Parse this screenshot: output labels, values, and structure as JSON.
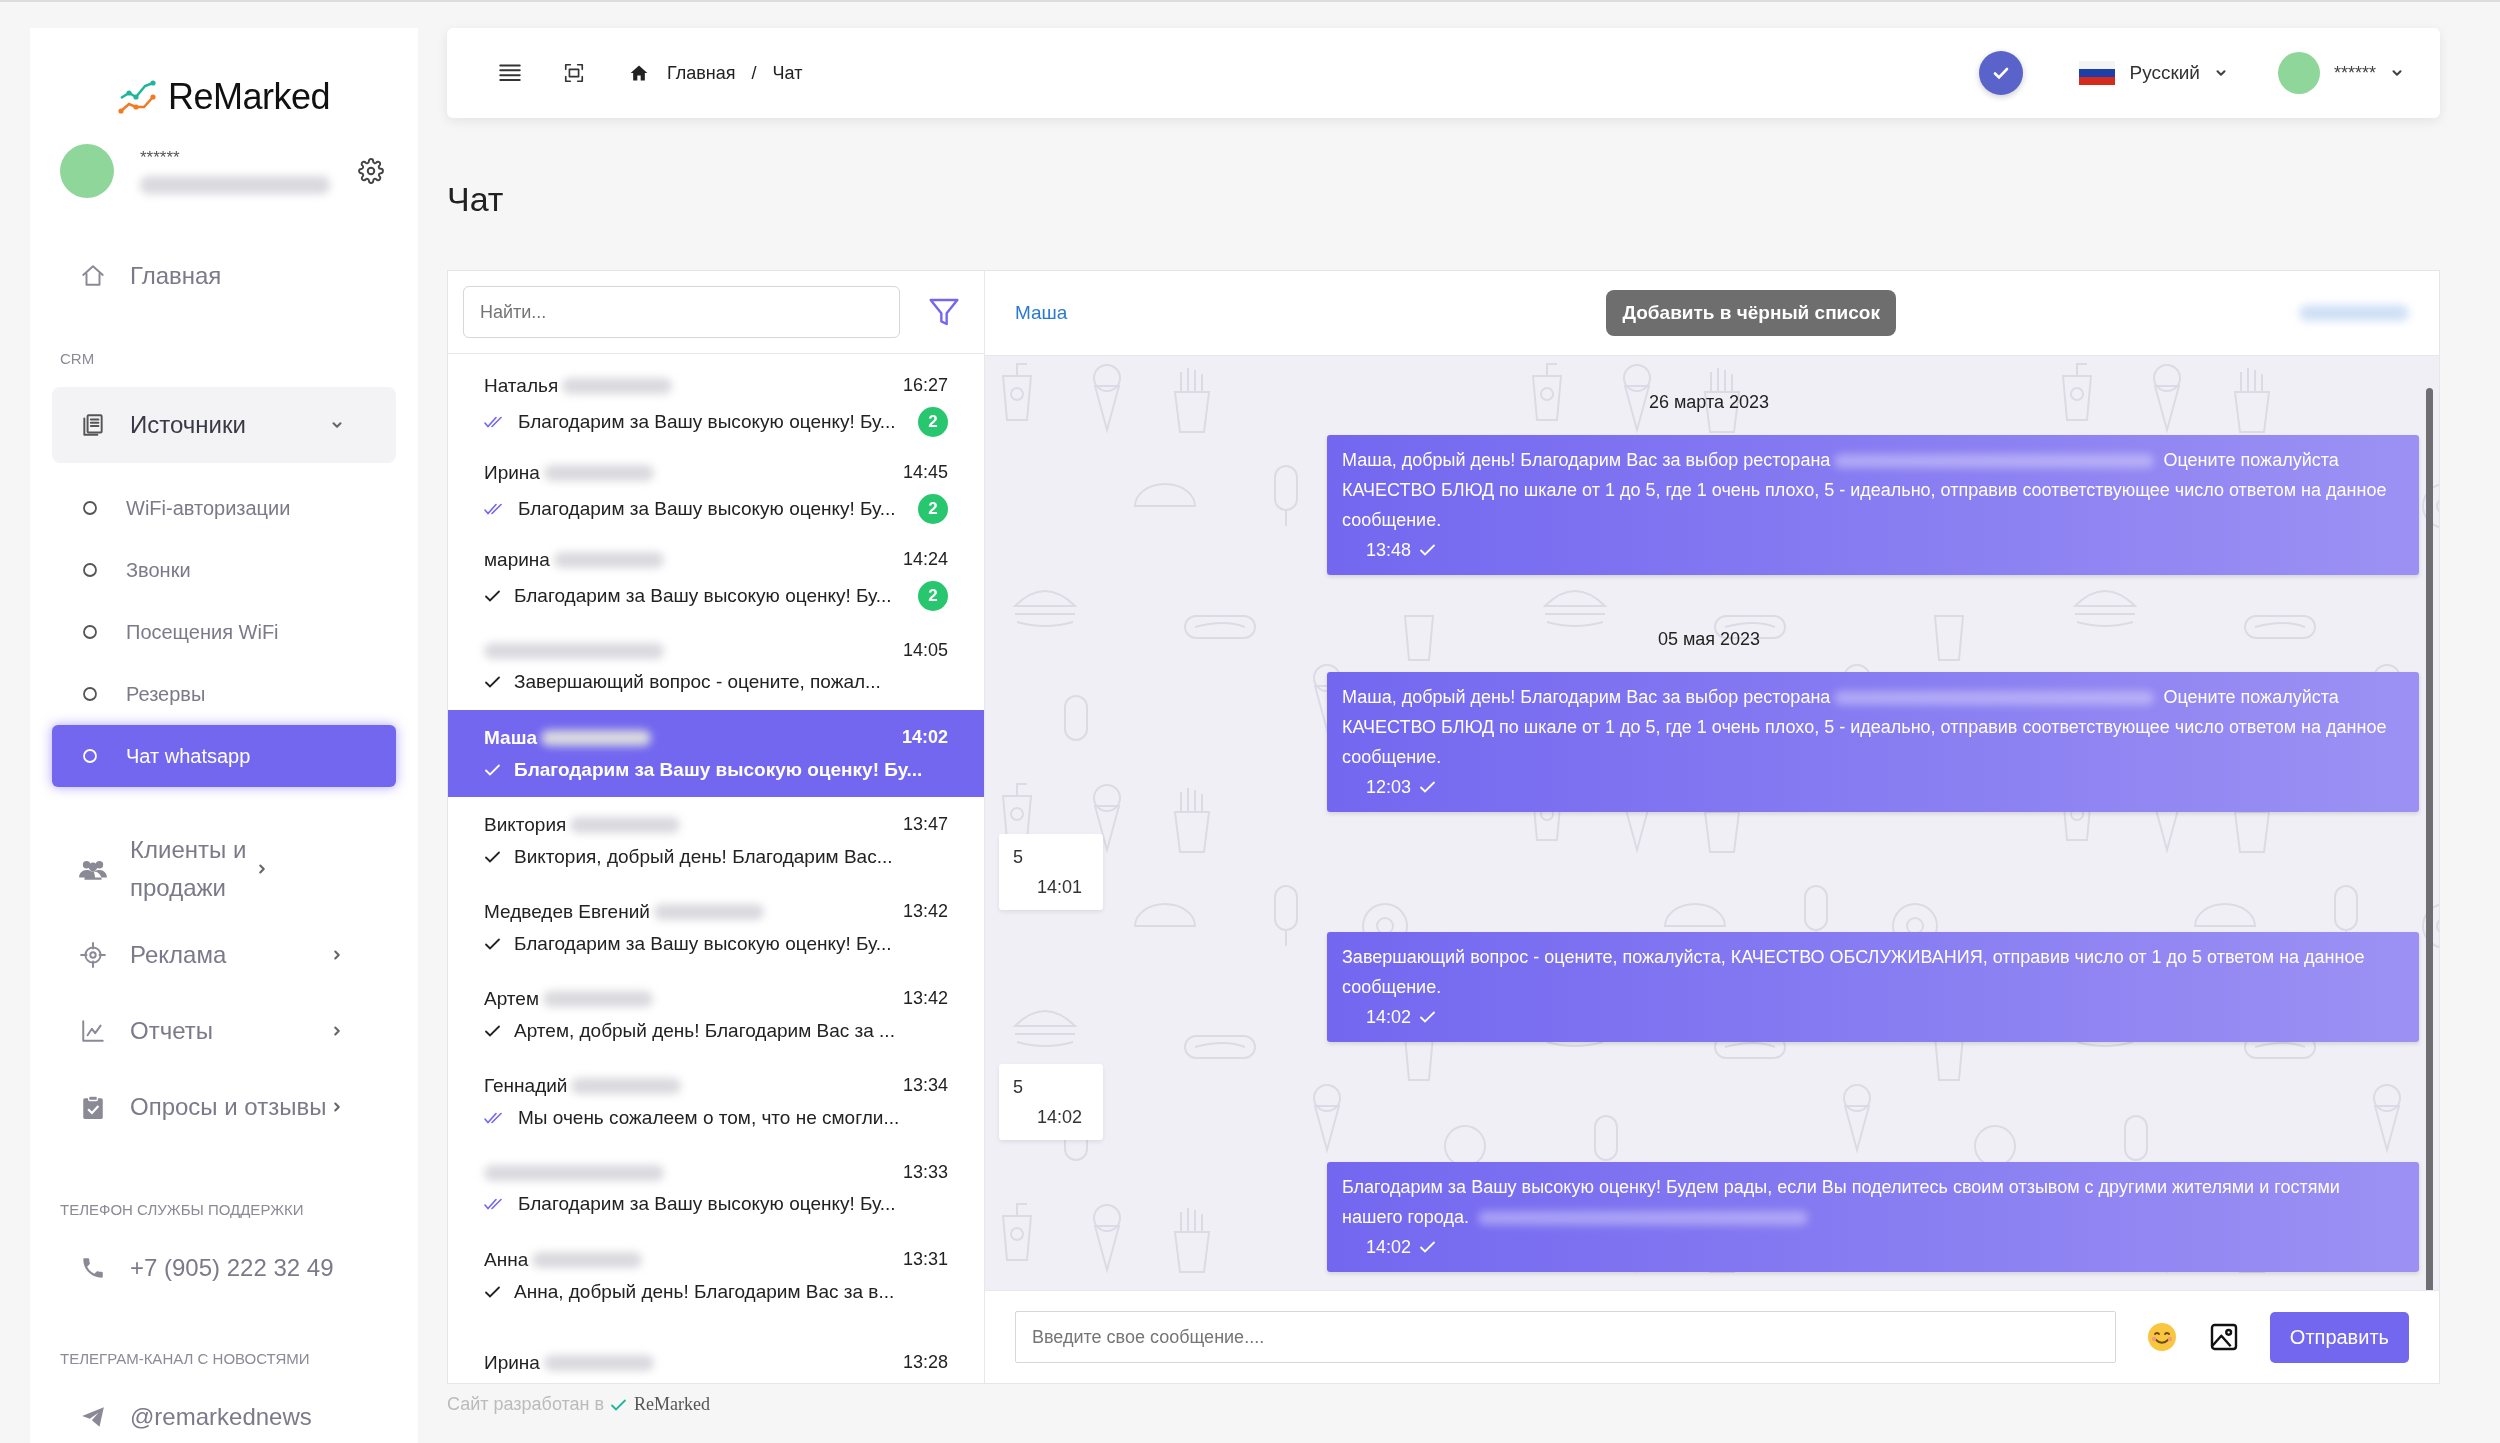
{
  "sidebar": {
    "logo": "ReMarked",
    "user": {
      "name": "******"
    },
    "nav": [
      {
        "kind": "link",
        "label": "Главная"
      },
      {
        "kind": "heading",
        "label": "CRM"
      },
      {
        "kind": "group",
        "label": "Источники",
        "expanded": true,
        "children": [
          {
            "label": "WiFi-авторизации",
            "selected": false
          },
          {
            "label": "Звонки",
            "selected": false
          },
          {
            "label": "Посещения WiFi",
            "selected": false
          },
          {
            "label": "Резервы",
            "selected": false
          },
          {
            "label": "Чат whatsapp",
            "selected": true
          }
        ]
      },
      {
        "kind": "group",
        "label": "Клиенты и продажи",
        "expanded": false
      },
      {
        "kind": "group",
        "label": "Реклама",
        "expanded": false
      },
      {
        "kind": "group",
        "label": "Отчеты",
        "expanded": false
      },
      {
        "kind": "group",
        "label": "Опросы и отзывы",
        "expanded": false
      }
    ],
    "support": {
      "heading": "ТЕЛЕФОН СЛУЖБЫ ПОДДЕРЖКИ",
      "phone": "+7 (905) 222 32 49"
    },
    "telegram": {
      "heading": "ТЕЛЕГРАМ-КАНАЛ С НОВОСТЯМИ",
      "handle": "@remarkednews"
    }
  },
  "topbar": {
    "breadcrumbs": [
      "Главная",
      "Чат"
    ],
    "breadcrumb_separator": "/",
    "language": "Русский",
    "user": "******"
  },
  "page_title": "Чат",
  "chat_list": {
    "search": {
      "placeholder": "Найти..."
    },
    "chats": [
      {
        "name": "Наталья",
        "time": "16:27",
        "preview": "Благодарим за Вашу высокую оценку! Бу...",
        "read": true,
        "unread": "2",
        "selected": false
      },
      {
        "name": "Ирина",
        "time": "14:45",
        "preview": "Благодарим за Вашу высокую оценку! Бу...",
        "read": true,
        "unread": "2",
        "selected": false
      },
      {
        "name": "марина",
        "time": "14:24",
        "preview": "Благодарим за Вашу высокую оценку! Бу...",
        "read": false,
        "unread": "2",
        "selected": false
      },
      {
        "time": "14:05",
        "preview": "Завершающий вопрос - оцените, пожал...",
        "read": false,
        "selected": false
      },
      {
        "name": "Маша",
        "time": "14:02",
        "preview": "Благодарим за Вашу высокую оценку! Бу...",
        "read": false,
        "selected": true
      },
      {
        "name": "Виктория",
        "time": "13:47",
        "preview": "Виктория, добрый день! Благодарим Вас...",
        "read": false,
        "selected": false
      },
      {
        "name": "Медведев Евгений",
        "time": "13:42",
        "preview": "Благодарим за Вашу высокую оценку! Бу...",
        "read": false,
        "selected": false
      },
      {
        "name": "Артем",
        "time": "13:42",
        "preview": "Артем, добрый день! Благодарим Вас за ...",
        "read": false,
        "selected": false
      },
      {
        "name": "Геннадий",
        "time": "13:34",
        "preview": "Мы очень сожалеем о том, что не смогли...",
        "read": true,
        "selected": false
      },
      {
        "time": "13:33",
        "preview": "Благодарим за Вашу высокую оценку! Бу...",
        "read": true,
        "selected": false
      },
      {
        "name": "Анна",
        "time": "13:31",
        "preview": "Анна, добрый день! Благодарим Вас за в...",
        "read": false,
        "selected": false
      },
      {
        "name": "Ирина",
        "time": "13:28",
        "selected": false
      }
    ]
  },
  "chat": {
    "contact": "Маша",
    "blacklist_button": "Добавить в чёрный список",
    "messages": [
      {
        "kind": "date",
        "text": "26 марта 2023"
      },
      {
        "kind": "outgoing",
        "parts": [
          "Маша, добрый день! Благодарим Вас за выбор ресторана",
          "Оцените пожалуйста КАЧЕСТВО БЛЮД по шкале от 1 до 5, где 1 очень плохо, 5 - идеально, отправив соответствующее число ответом на данное сообщение."
        ],
        "time": "13:48"
      },
      {
        "kind": "date",
        "text": "05 мая 2023"
      },
      {
        "kind": "outgoing",
        "parts": [
          "Маша, добрый день! Благодарим Вас за выбор ресторана",
          "Оцените пожалуйста КАЧЕСТВО БЛЮД по шкале от 1 до 5, где 1 очень плохо, 5 - идеально, отправив соответствующее число ответом на данное сообщение."
        ],
        "time": "12:03"
      },
      {
        "kind": "incoming",
        "parts": [
          "5"
        ],
        "time": "14:01"
      },
      {
        "kind": "outgoing",
        "parts": [
          "Завершающий вопрос - оцените, пожалуйста, КАЧЕСТВО ОБСЛУЖИВАНИЯ, отправив число от 1 до 5 ответом на данное сообщение."
        ],
        "time": "14:02"
      },
      {
        "kind": "incoming",
        "parts": [
          "5"
        ],
        "time": "14:02"
      },
      {
        "kind": "outgoing",
        "parts": [
          "Благодарим за Вашу высокую оценку! Будем рады, если Вы поделитесь своим отзывом с другими жителями и гостями нашего города."
        ],
        "redacted_end": true,
        "time": "14:02"
      }
    ],
    "input": {
      "placeholder": "Введите свое сообщение...."
    },
    "send_button": "Отправить"
  },
  "footer": {
    "text": "Сайт разработан в",
    "logo": "ReMarked"
  }
}
